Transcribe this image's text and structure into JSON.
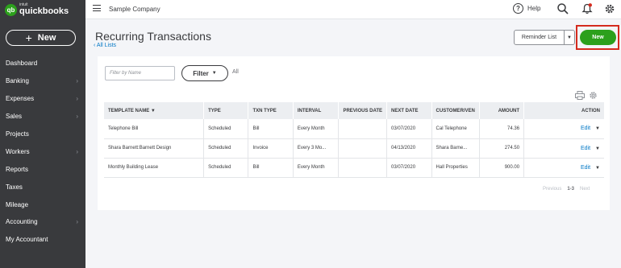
{
  "sidebar": {
    "logo_small": "intuit",
    "logo_main": "quickbooks",
    "logo_mark": "qb",
    "new_label": "New",
    "items": [
      {
        "label": "Dashboard",
        "chevron": false
      },
      {
        "label": "Banking",
        "chevron": true
      },
      {
        "label": "Expenses",
        "chevron": true
      },
      {
        "label": "Sales",
        "chevron": true
      },
      {
        "label": "Projects",
        "chevron": false
      },
      {
        "label": "Workers",
        "chevron": true
      },
      {
        "label": "Reports",
        "chevron": false
      },
      {
        "label": "Taxes",
        "chevron": false
      },
      {
        "label": "Mileage",
        "chevron": false
      },
      {
        "label": "Accounting",
        "chevron": true
      },
      {
        "label": "My Accountant",
        "chevron": false
      }
    ]
  },
  "topbar": {
    "company": "Sample Company",
    "help_label": "Help",
    "icons": [
      "menu-icon",
      "help-icon",
      "search-icon",
      "notification-bell-icon",
      "gear-icon"
    ]
  },
  "header": {
    "title": "Recurring Transactions",
    "back_link": "All Lists",
    "reminder_list": "Reminder List",
    "new_button": "New"
  },
  "filters": {
    "name_placeholder": "Filter by Name",
    "filter_button": "Filter",
    "filter_status": "All"
  },
  "table": {
    "columns": [
      "TEMPLATE NAME ▼",
      "TYPE",
      "TXN TYPE",
      "INTERVAL",
      "PREVIOUS DATE",
      "NEXT DATE",
      "CUSTOMER/VEN",
      "AMOUNT",
      "ACTION"
    ],
    "rows": [
      {
        "name": "Telephone Bill",
        "type": "Scheduled",
        "txn": "Bill",
        "interval": "Every Month",
        "prev": "",
        "next": "03/07/2020",
        "customer": "Cal Telephone",
        "amount": "74.36",
        "action": "Edit"
      },
      {
        "name": "Shara Barnett:Barnett Design",
        "type": "Scheduled",
        "txn": "Invoice",
        "interval": "Every 3 Mo...",
        "prev": "",
        "next": "04/13/2020",
        "customer": "Shara Barne...",
        "amount": "274.50",
        "action": "Edit"
      },
      {
        "name": "Monthly Building Lease",
        "type": "Scheduled",
        "txn": "Bill",
        "interval": "Every Month",
        "prev": "",
        "next": "03/07/2020",
        "customer": "Hall Properties",
        "amount": "900.00",
        "action": "Edit"
      }
    ]
  },
  "pager": {
    "previous": "Previous",
    "range": "1-3",
    "next": "Next"
  },
  "colors": {
    "brand_green": "#2ca01c",
    "sidebar_bg": "#393a3d",
    "link_blue": "#0077c5",
    "highlight_red": "#d52b1e"
  }
}
